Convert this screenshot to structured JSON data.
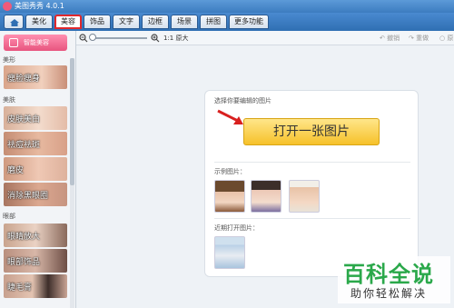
{
  "window": {
    "title": "美图秀秀 4.0.1"
  },
  "tabs": [
    {
      "label": "美化"
    },
    {
      "label": "美容"
    },
    {
      "label": "饰品"
    },
    {
      "label": "文字"
    },
    {
      "label": "边框"
    },
    {
      "label": "场景"
    },
    {
      "label": "拼图"
    },
    {
      "label": "更多功能"
    }
  ],
  "active_tab": "美容",
  "toolbar": {
    "zoom_label": "1:1 原大",
    "undo": "撤销",
    "redo": "重做",
    "reset": "原"
  },
  "sidebar": {
    "smart_button": "智能美容",
    "categories": [
      "美形",
      "美肤",
      "眼部"
    ],
    "items": [
      {
        "label": "瘦脸瘦身"
      },
      {
        "label": "皮肤美白"
      },
      {
        "label": "祛痘祛斑"
      },
      {
        "label": "磨皮"
      },
      {
        "label": "消除黑眼圈"
      },
      {
        "label": "眼睛放大"
      },
      {
        "label": "眼部饰品"
      },
      {
        "label": "睫毛膏"
      }
    ]
  },
  "panel": {
    "prompt": "选择你要编辑的图片",
    "open_button": "打开一张图片",
    "samples_label": "示例图片：",
    "recent_label": "近期打开图片："
  },
  "watermark": {
    "big": "百科全说",
    "small": "助你轻松解决"
  },
  "colors": {
    "active_tab_border": "#e0282c",
    "open_button": "#f6c12a",
    "watermark_green": "#2aa84a",
    "title_bar": "#3c7cc0"
  }
}
